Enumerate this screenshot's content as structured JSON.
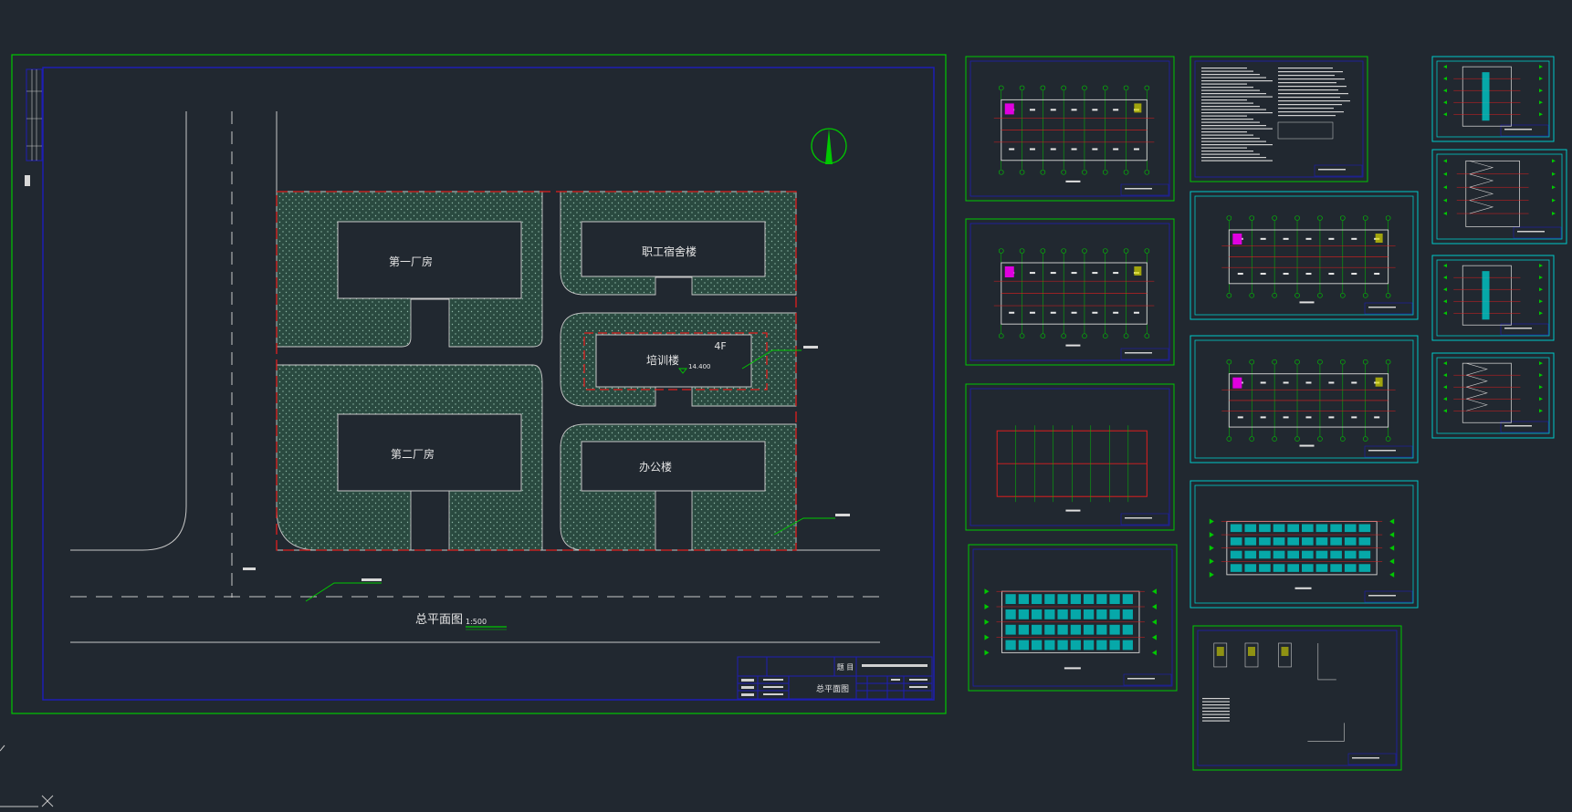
{
  "colors": {
    "background": "#212830",
    "frame_green": "#00c800",
    "frame_blue": "#1e1eb4",
    "site_red": "#e01e1e",
    "line_white": "#c8c8c8",
    "accent_magenta": "#e000e0",
    "accent_cyan": "#00c8c8",
    "accent_yellow": "#d8d800"
  },
  "site_plan": {
    "buildings": {
      "factory_1": "第一厂房",
      "dormitory": "职工宿舍楼",
      "training": "培训楼",
      "factory_2": "第二厂房",
      "office": "办公楼"
    },
    "training_floors": "4F",
    "training_elevation": "14.400",
    "plan_title": "总平面图",
    "plan_scale": "1:500"
  },
  "title_block": {
    "label_project": "题 目",
    "drawing_name": "总平面图"
  },
  "sheets": [
    {
      "id": "sheet-floor-plan-1",
      "icon": "floor-plan"
    },
    {
      "id": "sheet-floor-plan-2",
      "icon": "floor-plan"
    },
    {
      "id": "sheet-roof-plan",
      "icon": "roof-plan"
    },
    {
      "id": "sheet-elevation-1",
      "icon": "elevation"
    },
    {
      "id": "sheet-design-notes",
      "icon": "notes"
    },
    {
      "id": "sheet-floor-plan-3",
      "icon": "floor-plan"
    },
    {
      "id": "sheet-floor-plan-4",
      "icon": "floor-plan"
    },
    {
      "id": "sheet-elevation-2",
      "icon": "elevation"
    },
    {
      "id": "sheet-details",
      "icon": "details"
    },
    {
      "id": "sheet-section-1",
      "icon": "section"
    },
    {
      "id": "sheet-section-2",
      "icon": "section"
    },
    {
      "id": "sheet-section-3",
      "icon": "section"
    },
    {
      "id": "sheet-stair-section",
      "icon": "section"
    }
  ]
}
